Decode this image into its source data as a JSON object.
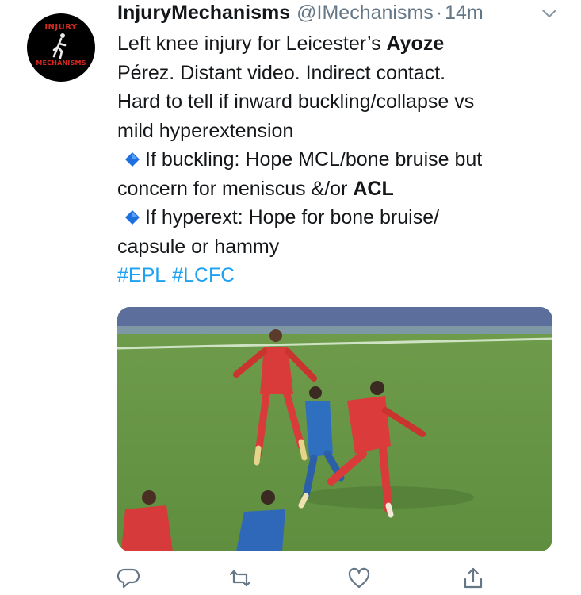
{
  "tweet": {
    "display_name": "InjuryMechanisms",
    "handle": "@IMechanisms",
    "separator": "·",
    "time": "14m",
    "avatar_logo_top": "INJURY",
    "avatar_logo_bottom": "MECHANISMS",
    "text": {
      "l1_a": "Left knee injury for Leicester’s ",
      "l1_b": "Ayoze",
      "l2": "Pérez. Distant video. Indirect contact.",
      "l3": "Hard to tell if inward buckling/collapse vs",
      "l4": "mild hyperextension",
      "l5": "If buckling: Hope MCL/bone bruise but",
      "l6_a": "concern for meniscus &/or ",
      "l6_b": "ACL",
      "l7": "If hyperext: Hope for bone bruise/",
      "l8": "capsule or hammy"
    },
    "hashtags": [
      "#EPL",
      "#LCFC"
    ]
  },
  "colors": {
    "link": "#1da1f2",
    "secondary_text": "#657786",
    "diamond": "#1e6fe0",
    "logo_red": "#d8281f"
  },
  "icons": {
    "reply": "reply-icon",
    "retweet": "retweet-icon",
    "like": "like-icon",
    "share": "share-icon",
    "caret": "chevron-down-icon"
  }
}
